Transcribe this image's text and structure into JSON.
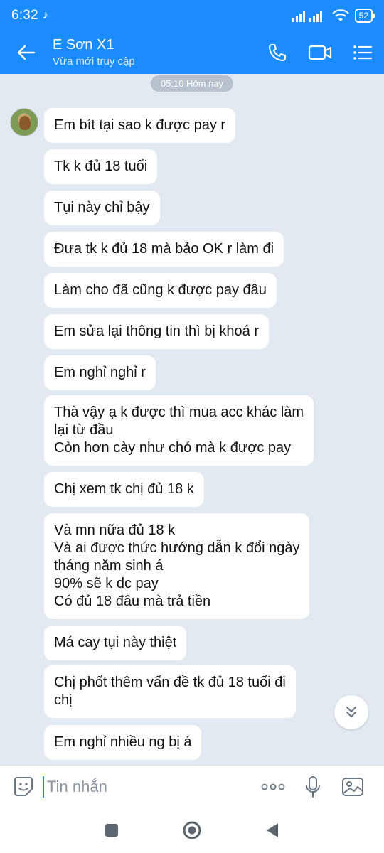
{
  "status": {
    "time": "6:32",
    "battery": "52",
    "colors": {
      "bar": "#1a8cff"
    }
  },
  "header": {
    "name": "E Sơn X1",
    "presence": "Vừa mới truy cập"
  },
  "chat": {
    "date_label": "05:10 Hôm nay",
    "messages": [
      "Em bít tại sao k được pay r",
      "Tk k đủ 18 tuổi",
      "Tụi này chỉ bậy",
      "Đưa tk k đủ 18 mà bảo OK r làm đi",
      "Làm cho đã cũng k được pay đâu",
      "Em sửa lại thông tin thì bị khoá r",
      "Em nghỉ nghỉ r",
      "Thà vậy ạ k được thì mua acc khác làm\nlại từ đầu\nCòn hơn cày như chó mà k được pay",
      "Chị xem tk chị đủ 18 k",
      "Và mn nữa đủ 18 k\nVà ai được thức hướng dẫn k đổi ngày\ntháng năm sinh á\n90% sẽ k dc pay\nCó đủ 18 đâu mà trả tiền",
      "Má cay tụi này thiệt",
      "Chị phốt thêm vấn đề tk đủ 18 tuổi đi\nchị",
      "Em nghỉ nhiều ng bị á"
    ]
  },
  "input": {
    "placeholder": "Tin nhắn"
  },
  "icons": {
    "back": "back-arrow-icon",
    "call": "phone-icon",
    "video": "video-call-icon",
    "menu": "menu-icon",
    "sticker": "sticker-icon",
    "more": "more-options-icon",
    "voice": "microphone-icon",
    "image": "image-icon",
    "scroll": "chevron-double-down-icon"
  }
}
